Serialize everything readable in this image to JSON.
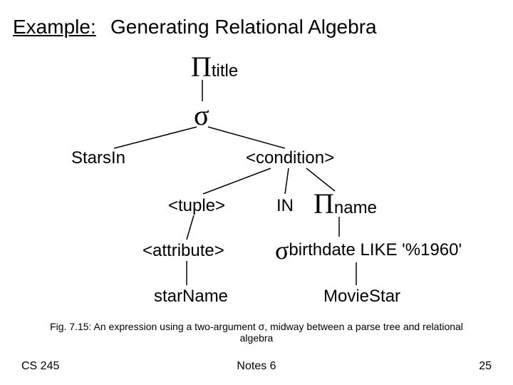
{
  "title": {
    "prefix": "Example:",
    "rest": "Generating Relational Algebra"
  },
  "nodes": {
    "pi_title": {
      "op": "Π",
      "sub": "title"
    },
    "sigma": {
      "op": "σ"
    },
    "starsin": "StarsIn",
    "condition": "<condition>",
    "tuple": "<tuple>",
    "in": "IN",
    "pi_name": {
      "op": "Π",
      "sub": "name"
    },
    "attribute": "<attribute>",
    "sigma_bd": {
      "op": "σ",
      "sub": "birthdate LIKE '%1960'"
    },
    "starname": "starName",
    "moviestar": "MovieStar"
  },
  "caption": "Fig. 7.15: An expression using a two-argument σ, midway between a parse tree and relational algebra",
  "footer": {
    "left": "CS 245",
    "mid": "Notes 6",
    "right": "25"
  }
}
